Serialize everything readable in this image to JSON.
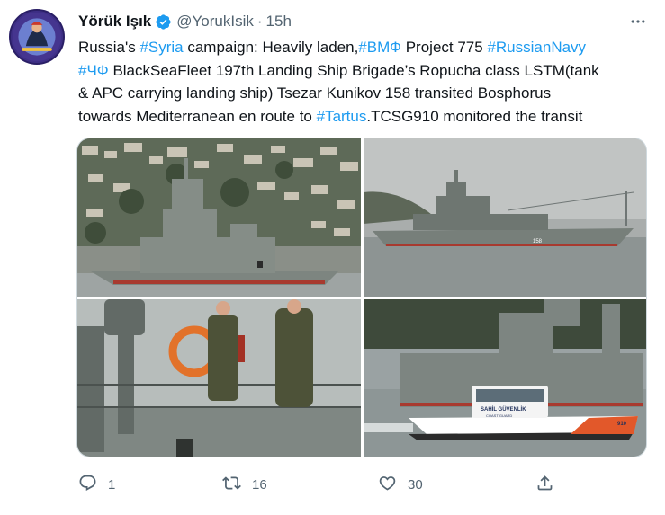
{
  "tweet": {
    "display_name": "Yörük Işık",
    "handle": "@YorukIsik",
    "dot": "·",
    "time": "15h",
    "verified_icon": "verified-badge-icon",
    "colors": {
      "link": "#1d9bf0",
      "text": "#0f1419",
      "secondary": "#536471",
      "verified": "#1d9bf0"
    },
    "text_lines": [
      [
        {
          "t": "Russia's ",
          "link": false
        },
        {
          "t": "#Syria",
          "link": true
        },
        {
          "t": " campaign: Heavily laden,",
          "link": false
        },
        {
          "t": "#ВМФ",
          "link": true
        },
        {
          "t": " Project 775 ",
          "link": false
        },
        {
          "t": "#RussianNavy",
          "link": true
        }
      ],
      [
        {
          "t": "#ЧФ",
          "link": true
        },
        {
          "t": " BlackSeaFleet 197th Landing Ship Brigade’s Ropucha class LSTM(tank",
          "link": false
        }
      ],
      [
        {
          "t": "& APC carrying landing ship) Tsezar Kunikov 158 transited Bosphorus",
          "link": false
        }
      ],
      [
        {
          "t": "towards Mediterranean en route to ",
          "link": false
        },
        {
          "t": "#Tartus",
          "link": true
        },
        {
          "t": ".TCSG910 monitored the transit",
          "link": false
        }
      ]
    ],
    "media": {
      "photos": [
        {
          "name": "photo-ship-city-background",
          "hull_number": ""
        },
        {
          "name": "photo-ship-bridge-background",
          "hull_number": "158"
        },
        {
          "name": "photo-sailors-on-deck",
          "hull_number": ""
        },
        {
          "name": "photo-coast-guard-boat",
          "boat_label": "SAHİL GÜVENLİK",
          "boat_sub_label": "COAST GUARD",
          "boat_number": "910"
        }
      ]
    },
    "actions": {
      "reply": {
        "icon": "reply-icon",
        "count": "1"
      },
      "retweet": {
        "icon": "retweet-icon",
        "count": "16"
      },
      "like": {
        "icon": "like-icon",
        "count": "30"
      },
      "share": {
        "icon": "share-icon",
        "count": ""
      }
    },
    "more_icon": "more-options-icon"
  }
}
